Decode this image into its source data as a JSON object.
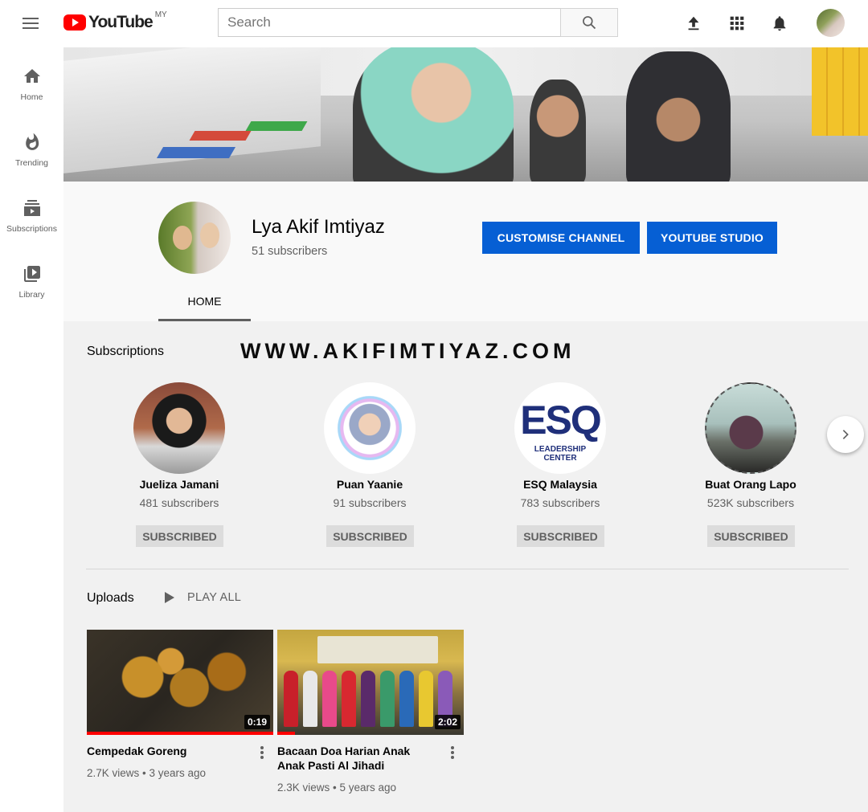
{
  "topbar": {
    "logo_text": "YouTube",
    "country": "MY",
    "search_placeholder": "Search"
  },
  "sidebar": {
    "items": [
      {
        "label": "Home",
        "icon": "home-icon"
      },
      {
        "label": "Trending",
        "icon": "flame-icon"
      },
      {
        "label": "Subscriptions",
        "icon": "subscriptions-icon"
      },
      {
        "label": "Library",
        "icon": "library-icon"
      }
    ]
  },
  "channel": {
    "name": "Lya Akif Imtiyaz",
    "subscribers": "51 subscribers",
    "customise_label": "CUSTOMISE CHANNEL",
    "studio_label": "YOUTUBE STUDIO",
    "tab_home": "HOME"
  },
  "subscriptions": {
    "title": "Subscriptions",
    "watermark": "WWW.AKIFIMTIYAZ.COM",
    "items": [
      {
        "name": "Jueliza Jamani",
        "count": "481 subscribers",
        "button": "SUBSCRIBED"
      },
      {
        "name": "Puan Yaanie",
        "count": "91 subscribers",
        "button": "SUBSCRIBED"
      },
      {
        "name": "ESQ Malaysia",
        "count": "783 subscribers",
        "button": "SUBSCRIBED",
        "logo_main": "ESQ",
        "logo_sub1": "LEADERSHIP",
        "logo_sub2": "CENTER"
      },
      {
        "name": "Buat Orang Lapo",
        "count": "523K subscribers",
        "button": "SUBSCRIBED"
      }
    ]
  },
  "uploads": {
    "title": "Uploads",
    "play_all": "PLAY ALL",
    "videos": [
      {
        "title": "Cempedak Goreng",
        "duration": "0:19",
        "meta": "2.7K views • 3 years ago"
      },
      {
        "title": "Bacaan Doa Harian Anak Anak Pasti Al Jihadi",
        "duration": "2:02",
        "meta": "2.3K views • 5 years ago"
      }
    ]
  },
  "colors": {
    "brand_red": "#ff0000",
    "primary_blue": "#065fd4",
    "text_secondary": "#606060"
  }
}
